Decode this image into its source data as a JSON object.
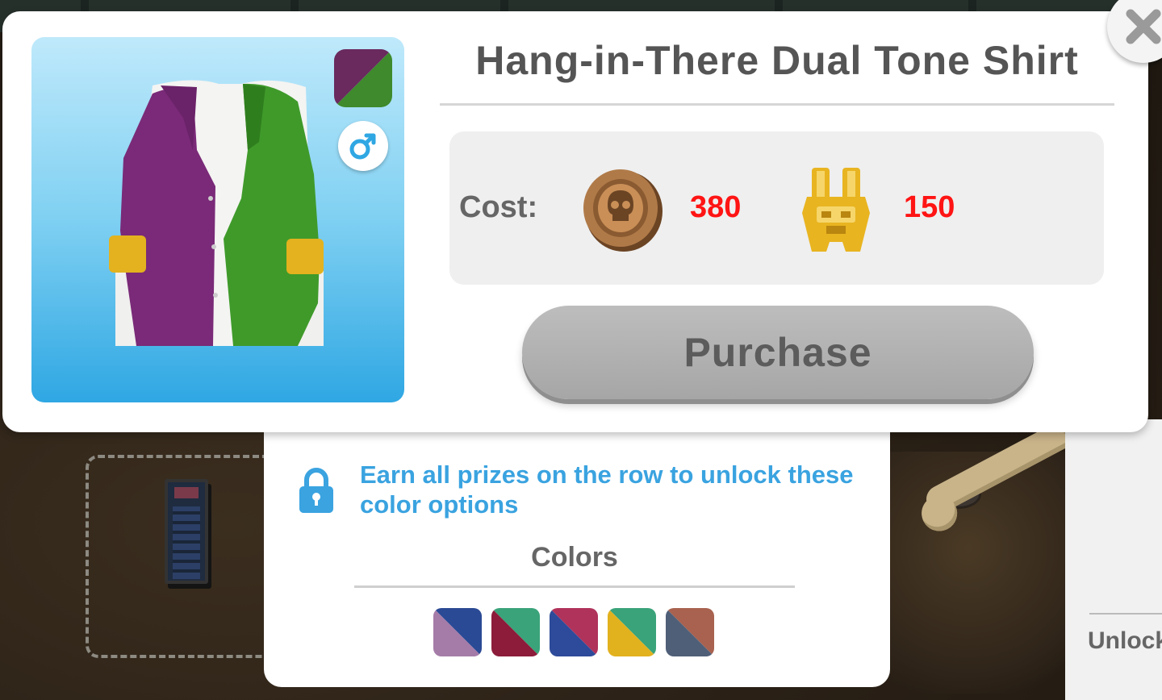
{
  "dialog": {
    "title": "Hang-in-There Dual Tone Shirt",
    "cost_label": "Cost:",
    "costs": [
      {
        "icon": "skull-coin-icon",
        "value": "380"
      },
      {
        "icon": "golden-totem-icon",
        "value": "150"
      }
    ],
    "purchase_label": "Purchase",
    "close_icon": "close-icon",
    "gender_icon": "male-icon",
    "selected_color": {
      "a": "#6a2a5e",
      "b": "#3e8a2c"
    },
    "preview_colors": {
      "left": "#7a2a78",
      "right": "#3f9a2a",
      "cuffs": "#e3b21e"
    }
  },
  "colors_panel": {
    "unlock_message": "Earn all prizes on the row to unlock these color options",
    "lock_icon": "lock-icon",
    "colors_title": "Colors",
    "swatches": [
      {
        "a": "#2b4a95",
        "b": "#a57ca8"
      },
      {
        "a": "#3aa37a",
        "b": "#8c1c3a"
      },
      {
        "a": "#b0335c",
        "b": "#2d4b9a"
      },
      {
        "a": "#3aa37a",
        "b": "#e2b11e"
      },
      {
        "a": "#a8624f",
        "b": "#4f5f78"
      }
    ]
  },
  "background": {
    "side_label": "Unlock"
  }
}
